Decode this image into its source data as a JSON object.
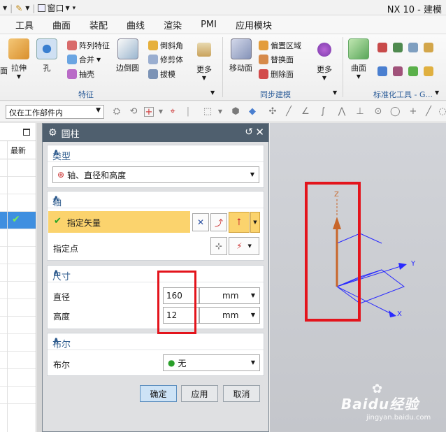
{
  "titlebar": {
    "window_menu": "窗口",
    "app_title": "NX 10 - 建模"
  },
  "menu": {
    "tabs": [
      "工具",
      "曲面",
      "装配",
      "曲线",
      "渲染",
      "PMI",
      "应用模块"
    ]
  },
  "ribbon": {
    "pull": "拉伸",
    "hole": "孔",
    "array": "阵列特征",
    "unite": "合并",
    "shell": "抽壳",
    "edge_blend": "边倒圆",
    "chamfer": "倒斜角",
    "trim_body": "修剪体",
    "draft": "拔模",
    "more1": "更多",
    "move_face": "移动面",
    "offset_region": "偏置区域",
    "replace_face": "替换面",
    "delete_face": "删除面",
    "more2": "更多",
    "surface": "曲面",
    "group_feature": "特征",
    "group_sync": "同步建模",
    "group_std": "标准化工具 - G..."
  },
  "toolbar": {
    "filter": "仅在工作部件内"
  },
  "navigator": {
    "col_latest": "最新"
  },
  "dialog": {
    "title": "圆柱",
    "type_section": "类型",
    "type_value": "轴、直径和高度",
    "axis_section": "轴",
    "specify_vector": "指定矢量",
    "specify_point": "指定点",
    "dims_section": "尺寸",
    "diameter_label": "直径",
    "diameter_value": "160",
    "diameter_unit": "mm",
    "height_label": "高度",
    "height_value": "12",
    "height_unit": "mm",
    "bool_section": "布尔",
    "bool_label": "布尔",
    "bool_value": "无",
    "ok": "确定",
    "apply": "应用",
    "cancel": "取消"
  },
  "viewport": {
    "axis_x": "X",
    "axis_y": "Y",
    "axis_z": "Z"
  },
  "watermark": {
    "brand": "Baidu经验",
    "url": "jingyan.baidu.com"
  },
  "colors": {
    "annotation_red": "#e3141c",
    "selected_blue": "#3f8fe0",
    "vector_orange": "#c8662a",
    "highlight_yellow": "#fbd36d"
  }
}
